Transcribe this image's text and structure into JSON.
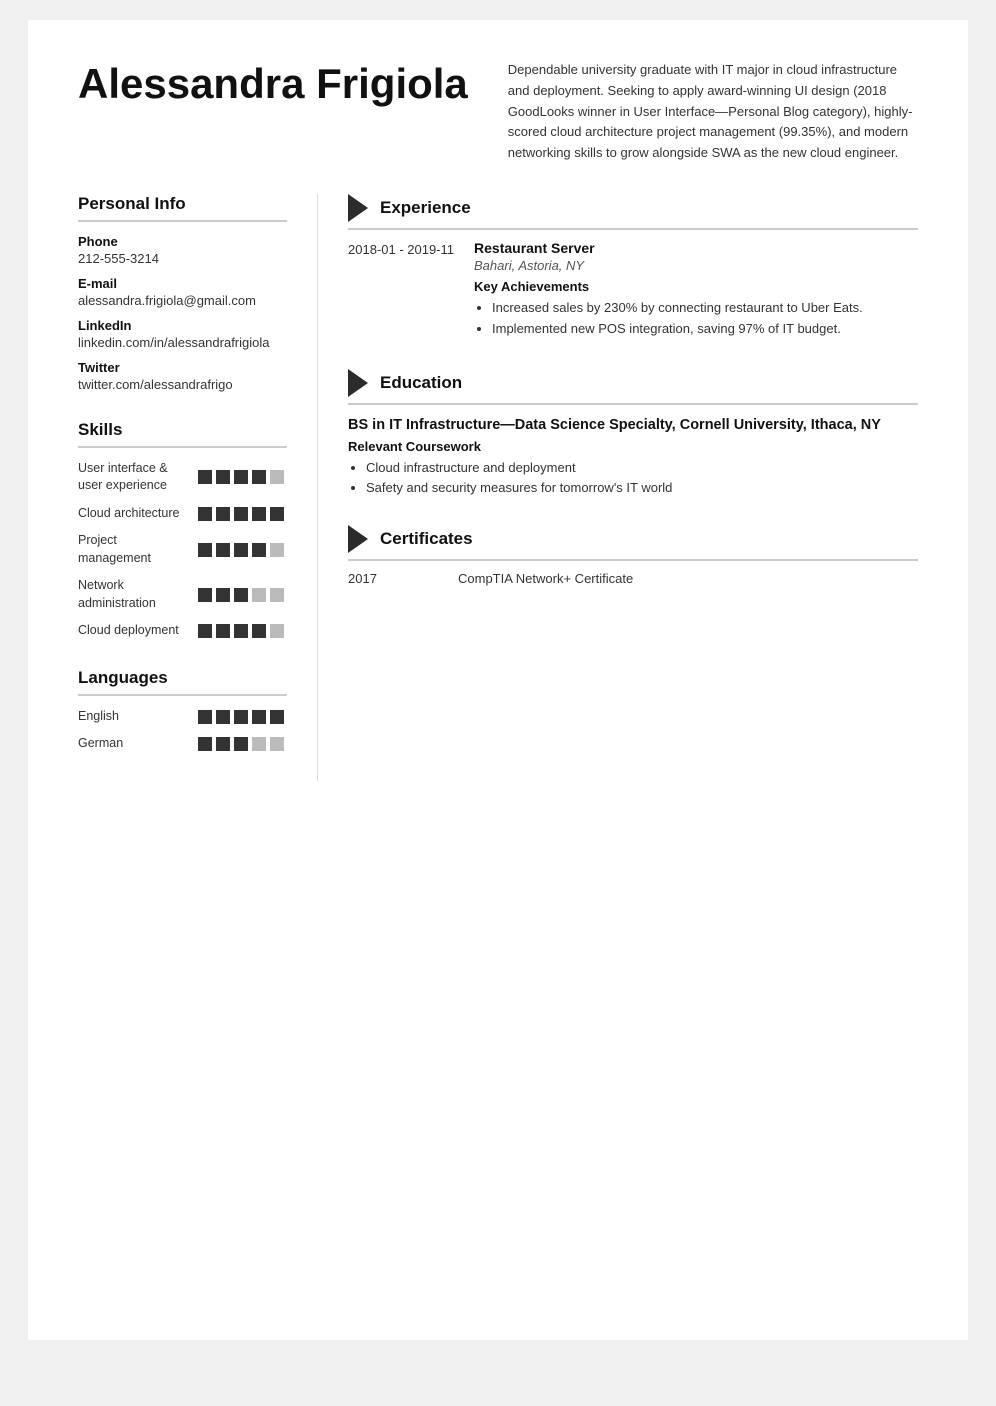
{
  "header": {
    "name": "Alessandra Frigiola",
    "summary": "Dependable university graduate with IT major in cloud infrastructure and deployment. Seeking to apply award-winning UI design (2018 GoodLooks winner in User Interface—Personal Blog category), highly-scored cloud architecture project management (99.35%), and modern networking skills to grow alongside SWA as the new cloud engineer."
  },
  "personal_info": {
    "section_title": "Personal Info",
    "items": [
      {
        "label": "Phone",
        "value": "212-555-3214"
      },
      {
        "label": "E-mail",
        "value": "alessandra.frigiola@gmail.com"
      },
      {
        "label": "LinkedIn",
        "value": "linkedin.com/in/alessandrafrigiola"
      },
      {
        "label": "Twitter",
        "value": "twitter.com/alessandrafrigo"
      }
    ]
  },
  "skills": {
    "section_title": "Skills",
    "items": [
      {
        "name": "User interface & user experience",
        "filled": 4,
        "total": 5
      },
      {
        "name": "Cloud architecture",
        "filled": 5,
        "total": 5
      },
      {
        "name": "Project management",
        "filled": 4,
        "total": 5
      },
      {
        "name": "Network administration",
        "filled": 3,
        "total": 5
      },
      {
        "name": "Cloud deployment",
        "filled": 4,
        "total": 5
      }
    ]
  },
  "languages": {
    "section_title": "Languages",
    "items": [
      {
        "name": "English",
        "filled": 5,
        "total": 5
      },
      {
        "name": "German",
        "filled": 3,
        "total": 5
      }
    ]
  },
  "experience": {
    "section_title": "Experience",
    "items": [
      {
        "date": "2018-01 - 2019-11",
        "title": "Restaurant Server",
        "subtitle": "Bahari, Astoria, NY",
        "key_label": "Key Achievements",
        "bullets": [
          "Increased sales by 230% by connecting restaurant to Uber Eats.",
          "Implemented new POS integration, saving 97% of IT budget."
        ]
      }
    ]
  },
  "education": {
    "section_title": "Education",
    "items": [
      {
        "title": "BS in IT Infrastructure—Data Science Specialty, Cornell University, Ithaca, NY",
        "key_label": "Relevant Coursework",
        "bullets": [
          "Cloud infrastructure and deployment",
          "Safety and security measures for tomorrow's IT world"
        ]
      }
    ]
  },
  "certificates": {
    "section_title": "Certificates",
    "items": [
      {
        "year": "2017",
        "name": "CompTIA Network+ Certificate"
      }
    ]
  }
}
